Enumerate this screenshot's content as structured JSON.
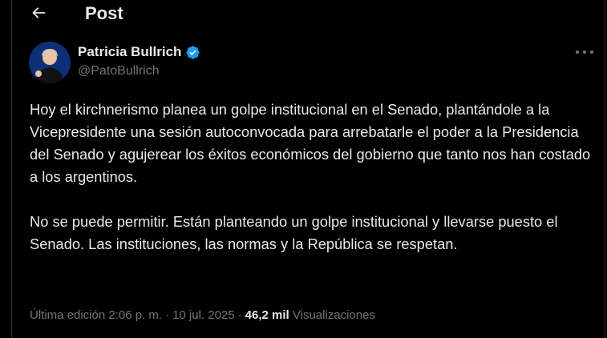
{
  "header": {
    "title": "Post",
    "back_icon": "arrow-left-icon"
  },
  "author": {
    "name": "Patricia Bullrich",
    "handle": "@PatoBullrich",
    "verified_icon": "verified-badge-icon",
    "verified_color": "#1d9bf0"
  },
  "post": {
    "paragraphs": [
      "Hoy el kirchnerismo planea un golpe institucional en el Senado, plantándole a la Vicepresidente una sesión autoconvocada para arrebatarle el poder a la Presidencia del Senado y agujerear los éxitos económicos del gobierno que tanto nos han costado a los argentinos.",
      "No se puede permitir. Están planteando un golpe institucional y llevarse puesto el Senado. Las instituciones, las normas y la República se respetan."
    ]
  },
  "meta": {
    "edited": "Última edición 2:06 p. m.",
    "separator": "·",
    "date": "10 jul. 2025",
    "views_count": "46,2 mil",
    "views_label": "Visualizaciones"
  },
  "colors": {
    "background": "#000000",
    "text": "#e7e9ea",
    "secondary": "#71767b",
    "border": "#2f3336"
  }
}
